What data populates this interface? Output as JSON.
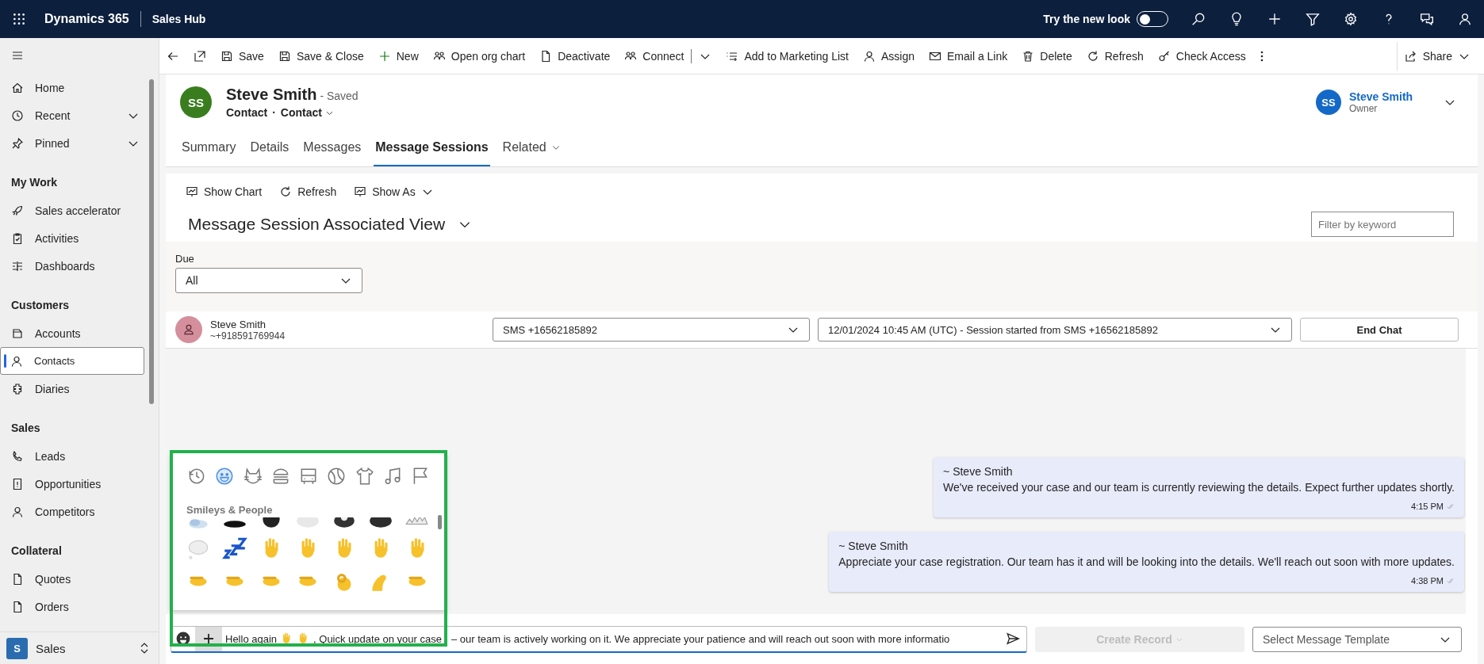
{
  "top_bar": {
    "app_name": "Dynamics 365",
    "area": "Sales Hub",
    "new_look": {
      "label": "Try the new look",
      "on": false
    }
  },
  "sidebar": {
    "sections": [
      {
        "items": [
          {
            "label": "Home",
            "kind": "link",
            "selected": false
          },
          {
            "label": "Recent",
            "kind": "group",
            "selected": false
          },
          {
            "label": "Pinned",
            "kind": "group",
            "selected": false
          }
        ]
      },
      {
        "heading": "My Work",
        "items": [
          {
            "label": "Sales accelerator",
            "kind": "link",
            "selected": false
          },
          {
            "label": "Activities",
            "kind": "link",
            "selected": false
          },
          {
            "label": "Dashboards",
            "kind": "link",
            "selected": false
          }
        ]
      },
      {
        "heading": "Customers",
        "items": [
          {
            "label": "Accounts",
            "kind": "link",
            "selected": false
          },
          {
            "label": "Contacts",
            "kind": "link",
            "selected": true
          },
          {
            "label": "Diaries",
            "kind": "link",
            "selected": false
          }
        ]
      },
      {
        "heading": "Sales",
        "items": [
          {
            "label": "Leads",
            "kind": "link",
            "selected": false
          },
          {
            "label": "Opportunities",
            "kind": "link",
            "selected": false
          },
          {
            "label": "Competitors",
            "kind": "link",
            "selected": false
          }
        ]
      },
      {
        "heading": "Collateral",
        "items": [
          {
            "label": "Quotes",
            "kind": "link",
            "selected": false
          },
          {
            "label": "Orders",
            "kind": "link",
            "selected": false
          }
        ]
      }
    ],
    "area_switcher": {
      "badge": "S",
      "label": "Sales"
    }
  },
  "command_bar": {
    "items": [
      {
        "label": "Save",
        "kind": "button"
      },
      {
        "label": "Save & Close",
        "kind": "button"
      },
      {
        "label": "New",
        "kind": "button"
      },
      {
        "label": "Open org chart",
        "kind": "button"
      },
      {
        "label": "Deactivate",
        "kind": "button"
      },
      {
        "label": "Connect",
        "kind": "split"
      },
      {
        "label": "Add to Marketing List",
        "kind": "button"
      },
      {
        "label": "Assign",
        "kind": "button"
      },
      {
        "label": "Email a Link",
        "kind": "button"
      },
      {
        "label": "Delete",
        "kind": "button"
      },
      {
        "label": "Refresh",
        "kind": "button"
      },
      {
        "label": "Check Access",
        "kind": "button"
      }
    ],
    "share": "Share"
  },
  "record": {
    "initials": "SS",
    "name": "Steve Smith",
    "status": "- Saved",
    "entity": "Contact",
    "separator": "·",
    "form": "Contact",
    "owner": {
      "initials": "SS",
      "name": "Steve Smith",
      "role": "Owner"
    }
  },
  "tabs": [
    {
      "label": "Summary",
      "kind": "tab",
      "selected": false
    },
    {
      "label": "Details",
      "kind": "tab",
      "selected": false
    },
    {
      "label": "Messages",
      "kind": "tab",
      "selected": false
    },
    {
      "label": "Message Sessions",
      "kind": "tab",
      "selected": true
    },
    {
      "label": "Related",
      "kind": "menu",
      "selected": false
    }
  ],
  "subgrid": {
    "toolbar": [
      "Show Chart",
      "Refresh",
      "Show As"
    ],
    "view_title": "Message Session Associated View",
    "filter_placeholder": "Filter by keyword",
    "due": {
      "label": "Due",
      "value": "All"
    }
  },
  "session": {
    "contact_name": "Steve Smith",
    "contact_phone": "~+918591769944",
    "channel": "SMS +16562185892",
    "session": "12/01/2024 10:45 AM (UTC) - Session started from SMS +16562185892",
    "end_button": "End Chat"
  },
  "messages": [
    {
      "sender": "~ Steve Smith",
      "text": "We've received your case and our team is currently reviewing the details. Expect further updates shortly.",
      "time": "4:15 PM"
    },
    {
      "sender": "~ Steve Smith",
      "text": "Appreciate your case registration. Our team has it and will be looking into the details. We'll reach out soon with more updates.",
      "time": "4:38 PM"
    }
  ],
  "emoji_picker": {
    "categories": [
      {
        "selected": false
      },
      {
        "selected": true
      },
      {
        "selected": false
      },
      {
        "selected": false
      },
      {
        "selected": false
      },
      {
        "selected": false
      },
      {
        "selected": false
      },
      {
        "selected": false
      },
      {
        "selected": false
      }
    ],
    "section": "Smileys & People"
  },
  "composer": {
    "text_before": "Hello again",
    "text_after": ", Quick update on your case",
    "text_rest": "– our team is actively working on it. We appreciate your patience and will reach out soon with more informatio",
    "create_record": {
      "label": "Create Record",
      "disabled": true
    },
    "template_placeholder": "Select Message Template"
  }
}
